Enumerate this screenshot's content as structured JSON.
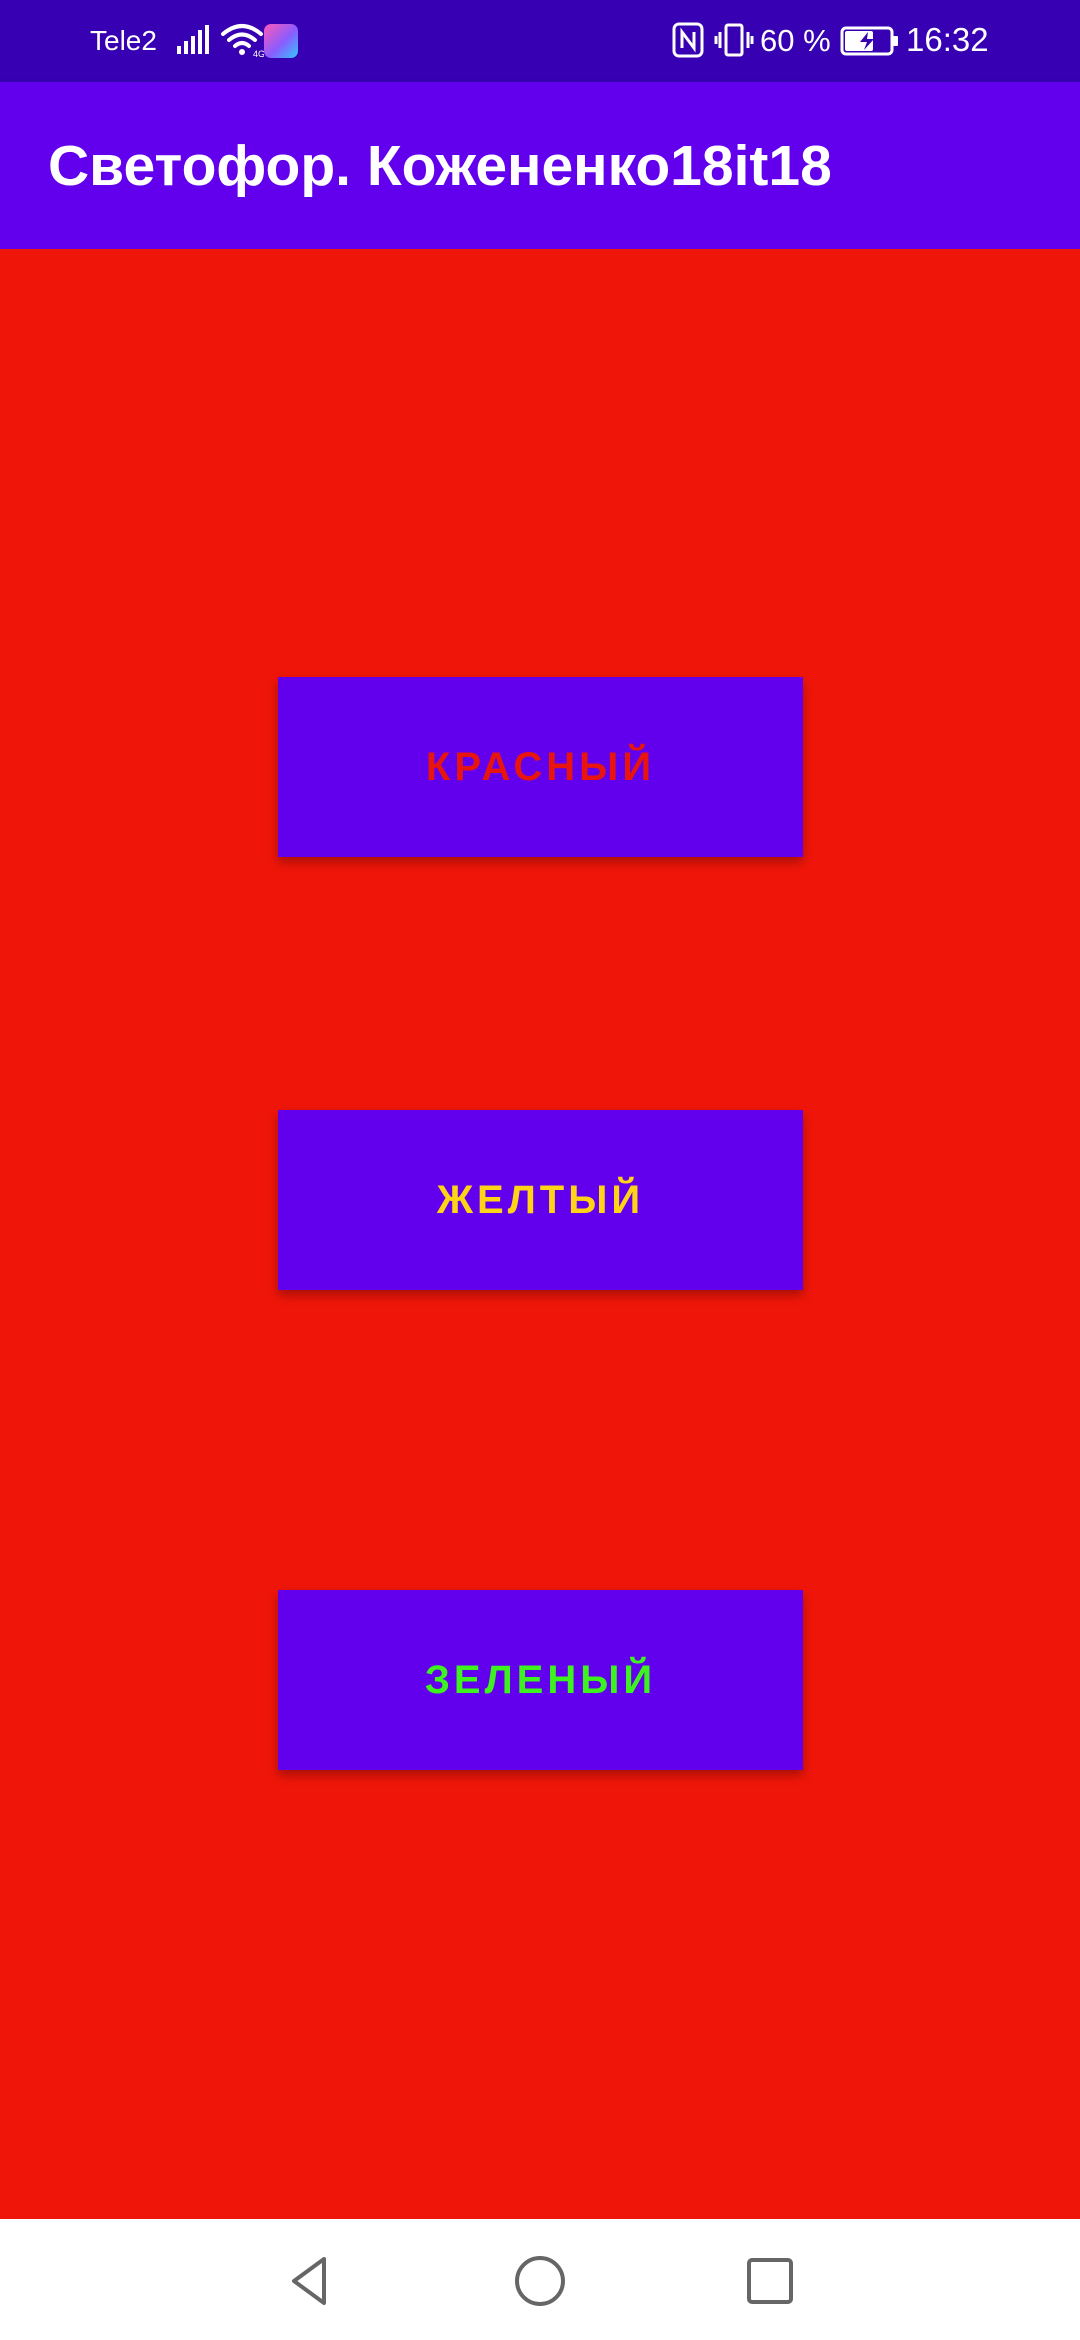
{
  "status_bar": {
    "carrier": "Tele2",
    "battery_percent": "60 %",
    "time": "16:32",
    "icons": [
      "signal-icon",
      "wifi-icon",
      "app-badge-icon",
      "nfc-icon",
      "vibrate-icon",
      "battery-charging-icon"
    ]
  },
  "app_bar": {
    "title": "Светофор. Кожененко18it18"
  },
  "main": {
    "background_color": "#ef1609",
    "buttons": [
      {
        "label": "КРАСНЫЙ",
        "text_color": "#e8140e"
      },
      {
        "label": "ЖЕЛТЫЙ",
        "text_color": "#ffd416"
      },
      {
        "label": "ЗЕЛЕНЫЙ",
        "text_color": "#3df21f"
      }
    ]
  },
  "nav_bar": {
    "icons": [
      "back-icon",
      "home-icon",
      "recents-icon"
    ]
  },
  "colors": {
    "status_bar": "#3700b3",
    "app_bar": "#6200ee",
    "button_background": "#6200ee"
  }
}
